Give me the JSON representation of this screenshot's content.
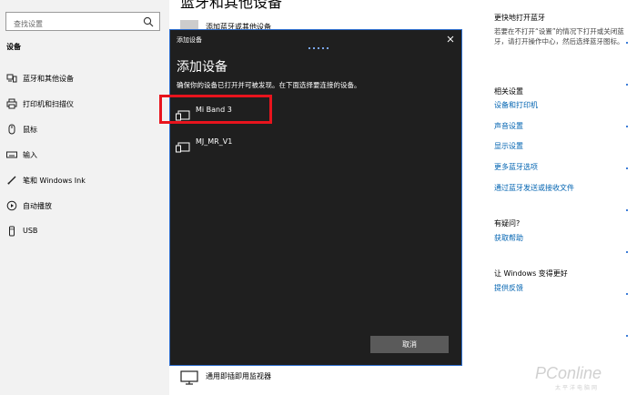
{
  "sidebar": {
    "search_placeholder": "查找设置",
    "section_title": "设备",
    "items": [
      {
        "label": "蓝牙和其他设备",
        "icon": "bluetooth-devices-icon"
      },
      {
        "label": "打印机和扫描仪",
        "icon": "printer-icon"
      },
      {
        "label": "鼠标",
        "icon": "mouse-icon"
      },
      {
        "label": "输入",
        "icon": "keyboard-icon"
      },
      {
        "label": "笔和 Windows Ink",
        "icon": "pen-icon"
      },
      {
        "label": "自动播放",
        "icon": "autoplay-icon"
      },
      {
        "label": "USB",
        "icon": "usb-icon"
      }
    ]
  },
  "main": {
    "title": "蓝牙和其他设备",
    "add_device_label": "添加蓝牙或其他设备",
    "monitor_label": "通用即插即用监视器"
  },
  "dialog": {
    "title": "添加设备",
    "heading": "添加设备",
    "subtitle": "确保你的设备已打开并可被发现。在下面选择要连接的设备。",
    "devices": [
      {
        "name": "Mi Band 3",
        "icon": "display-device-icon"
      },
      {
        "name": "MJ_MR_V1",
        "icon": "display-device-icon"
      }
    ],
    "cancel_label": "取消",
    "highlight_color": "#e8141d",
    "background_color": "#1f1f1f"
  },
  "right": {
    "quick_bt_title": "更快地打开蓝牙",
    "quick_bt_desc": "若要在不打开“设置”的情况下打开或关闭蓝牙，请打开操作中心，然后选择蓝牙图标。",
    "related_title": "相关设置",
    "related_links": [
      "设备和打印机",
      "声音设置",
      "显示设置",
      "更多蓝牙选项",
      "通过蓝牙发送或接收文件"
    ],
    "help_title": "有疑问?",
    "help_link": "获取帮助",
    "feedback_title": "让 Windows 变得更好",
    "feedback_link": "提供反馈",
    "link_color": "#0063b1"
  },
  "watermark": {
    "main": "PConline",
    "sub": "太平洋电脑网"
  }
}
